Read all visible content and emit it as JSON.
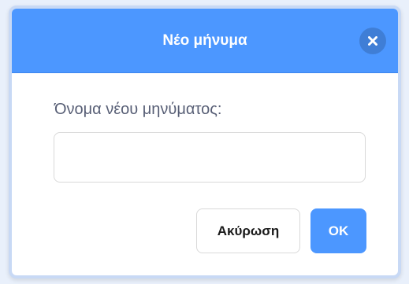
{
  "dialog": {
    "title": "Νέο μήνυμα",
    "close_icon": "close-icon",
    "field_label": "Όνομα νέου μηνύματος:",
    "field_value": "",
    "field_placeholder": "",
    "cancel_label": "Ακύρωση",
    "ok_label": "OK"
  },
  "colors": {
    "header": "#4c97ff",
    "ok_button": "#4c97ff",
    "label_text": "#575e75",
    "dialog_border": "#c8d9f5"
  }
}
